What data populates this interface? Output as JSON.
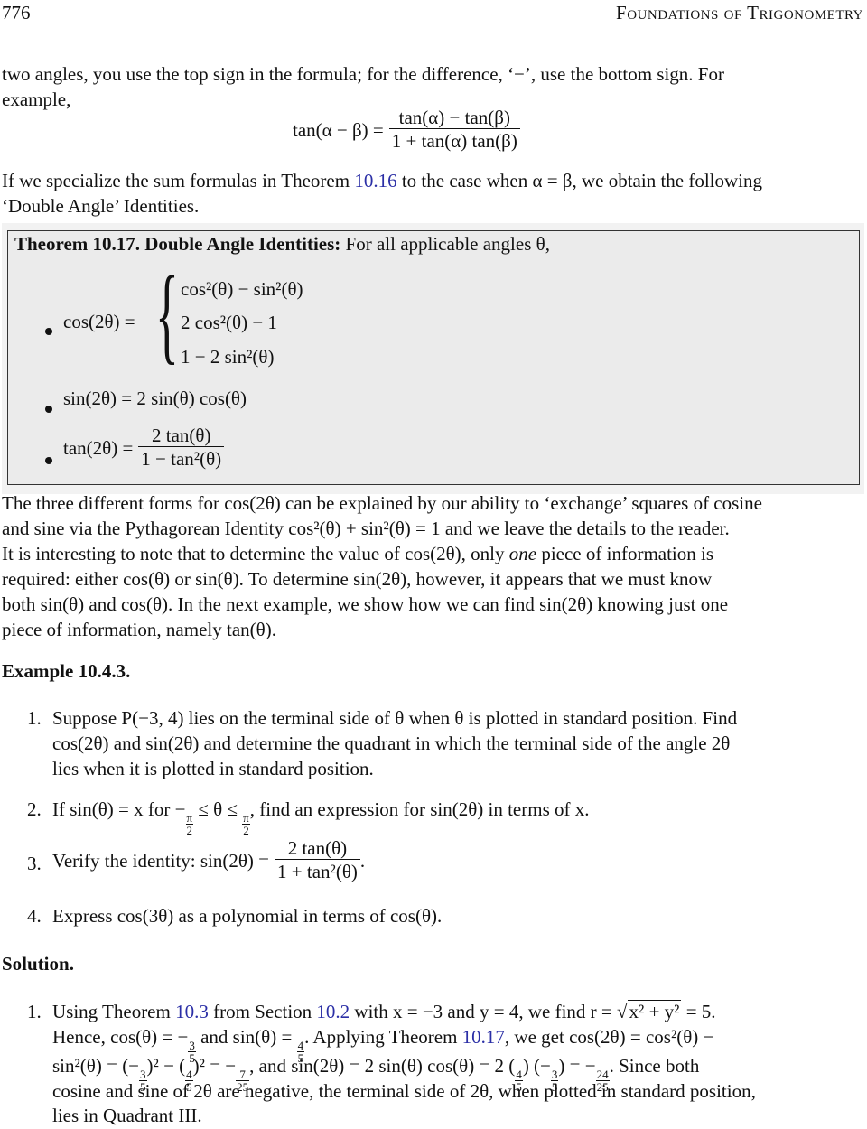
{
  "header": {
    "page_number": "776",
    "running_title": "Foundations of Trigonometry"
  },
  "intro": {
    "line1": "two angles, you use the top sign in the formula; for the difference, ‘−’, use the bottom sign. For",
    "line2": "example,",
    "formula_lhs": "tan(α − β) =",
    "formula_num": "tan(α) − tan(β)",
    "formula_den": "1 + tan(α) tan(β)",
    "specialize_pre": "If we specialize the sum formulas in Theorem ",
    "specialize_link": "10.16",
    "specialize_post": " to the case when α = β, we obtain the following",
    "specialize_line2": "‘Double Angle’ Identities."
  },
  "theorem": {
    "label": "Theorem 10.17.",
    "name": "Double Angle Identities:",
    "lead": "For all applicable angles θ,",
    "cos_lhs": "cos(2θ) =",
    "cos_cases": [
      "cos²(θ) − sin²(θ)",
      "2 cos²(θ) − 1",
      "1 − 2 sin²(θ)"
    ],
    "sin_identity": "sin(2θ) = 2 sin(θ) cos(θ)",
    "tan_lhs": "tan(2θ) =",
    "tan_num": "2 tan(θ)",
    "tan_den": "1 − tan²(θ)"
  },
  "discussion": [
    "The three different forms for cos(2θ) can be explained by our ability to ‘exchange’ squares of cosine",
    "and sine via the Pythagorean Identity cos²(θ) + sin²(θ) = 1 and we leave the details to the reader.",
    "It is interesting to note that to determine the value of cos(2θ), only",
    "one",
    "piece of information is",
    "required:  either cos(θ) or sin(θ).  To determine sin(2θ), however, it appears that we must know",
    "both sin(θ) and cos(θ).  In the next example, we show how we can find sin(2θ) knowing just one",
    "piece of information, namely tan(θ)."
  ],
  "example": {
    "title": "Example 10.4.3.",
    "items": [
      {
        "number": "1.",
        "lines": [
          "Suppose P(−3, 4) lies on the terminal side of θ when θ is plotted in standard position. Find",
          "cos(2θ) and sin(2θ) and determine the quadrant in which the terminal side of the angle 2θ",
          "lies when it is plotted in standard position."
        ]
      },
      {
        "number": "2.",
        "pre": "If sin(θ) = x for −",
        "frac1_num": "π",
        "frac1_den": "2",
        "mid": " ≤ θ ≤ ",
        "frac2_num": "π",
        "frac2_den": "2",
        "post": ", find an expression for sin(2θ) in terms of x."
      },
      {
        "number": "3.",
        "pre": "Verify the identity: sin(2θ) =",
        "num": "2 tan(θ)",
        "den": "1 + tan²(θ)",
        "post": "."
      },
      {
        "number": "4.",
        "text": "Express cos(3θ) as a polynomial in terms of cos(θ)."
      }
    ]
  },
  "solution": {
    "title": "Solution.",
    "item1": {
      "number": "1.",
      "l1_a": "Using Theorem ",
      "l1_link1": "10.3",
      "l1_b": " from Section ",
      "l1_link2": "10.2",
      "l1_c": " with x = −3 and y = 4, we find r = ",
      "l1_sqrt": "x² + y²",
      "l1_d": " = 5.",
      "l2_a": "Hence, cos(θ) = −",
      "l2_f1n": "3",
      "l2_f1d": "5",
      "l2_b": " and sin(θ) = ",
      "l2_f2n": "4",
      "l2_f2d": "5",
      "l2_c": ".  Applying Theorem ",
      "l2_link": "10.17",
      "l2_d": ", we get cos(2θ) = cos²(θ) −",
      "l3_a": "sin²(θ) = (−",
      "l3_f1n": "3",
      "l3_f1d": "5",
      "l3_b": ")² − (",
      "l3_f2n": "4",
      "l3_f2d": "5",
      "l3_c": ")² = −",
      "l3_f3n": "7",
      "l3_f3d": "25",
      "l3_d": ", and sin(2θ) = 2 sin(θ) cos(θ) = 2 (",
      "l3_f4n": "4",
      "l3_f4d": "5",
      "l3_e": ") (−",
      "l3_f5n": "3",
      "l3_f5d": "5",
      "l3_f": ") = −",
      "l3_f6n": "24",
      "l3_f6d": "25",
      "l3_g": ". Since both",
      "l4": "cosine and sine of 2θ are negative, the terminal side of 2θ, when plotted in standard position,",
      "l5": "lies in Quadrant III."
    }
  },
  "colors": {
    "link": "#2b2fa6",
    "theorem_background": "#ebebeb",
    "theorem_border": "#333333"
  }
}
